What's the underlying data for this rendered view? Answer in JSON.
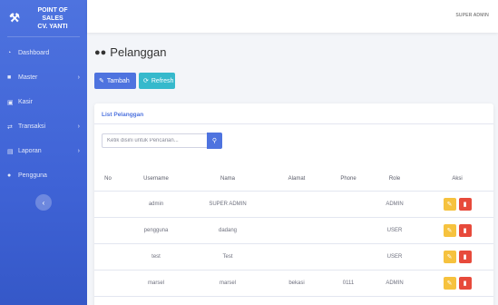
{
  "brand": {
    "line1": "POINT OF",
    "line2": "SALES",
    "line3": "CV. YANTI"
  },
  "sidebar": {
    "items": [
      {
        "label": "Dashboard",
        "icon": "gauge-icon",
        "has_chevron": false
      },
      {
        "label": "Master",
        "icon": "folder-icon",
        "has_chevron": true
      },
      {
        "label": "Kasir",
        "icon": "cart-icon",
        "has_chevron": false
      },
      {
        "label": "Transaksi",
        "icon": "exchange-icon",
        "has_chevron": true
      },
      {
        "label": "Laporan",
        "icon": "report-icon",
        "has_chevron": true
      },
      {
        "label": "Pengguna",
        "icon": "users-icon",
        "has_chevron": false
      }
    ],
    "toggle_icon": "chevron-left-icon"
  },
  "topbar": {
    "user_name": "SUPER ADMIN"
  },
  "page": {
    "title": "Pelanggan",
    "title_icon": "users-icon"
  },
  "toolbar": {
    "add_label": "Tambah",
    "refresh_label": "Refresh"
  },
  "card": {
    "title": "List Pelanggan"
  },
  "search": {
    "placeholder": "Ketik disini untuk Pencarian..."
  },
  "table": {
    "headers": {
      "no": "No",
      "username": "Username",
      "nama": "Nama",
      "alamat": "Alamat",
      "phone": "Phone",
      "role": "Role",
      "aksi": "Aksi"
    },
    "rows": [
      {
        "no": "",
        "username": "admin",
        "nama": "SUPER ADMIN",
        "alamat": "",
        "phone": "",
        "role": "ADMIN"
      },
      {
        "no": "",
        "username": "pengguna",
        "nama": "dadang",
        "alamat": "",
        "phone": "",
        "role": "USER"
      },
      {
        "no": "",
        "username": "test",
        "nama": "Test",
        "alamat": "",
        "phone": "",
        "role": "USER"
      },
      {
        "no": "",
        "username": "marsel",
        "nama": "marsel",
        "alamat": "bekasi",
        "phone": "0111",
        "role": "ADMIN"
      }
    ]
  },
  "colors": {
    "primary": "#4e73df",
    "info": "#36b9cc",
    "warning": "#f6c23e",
    "danger": "#e74a3b"
  }
}
